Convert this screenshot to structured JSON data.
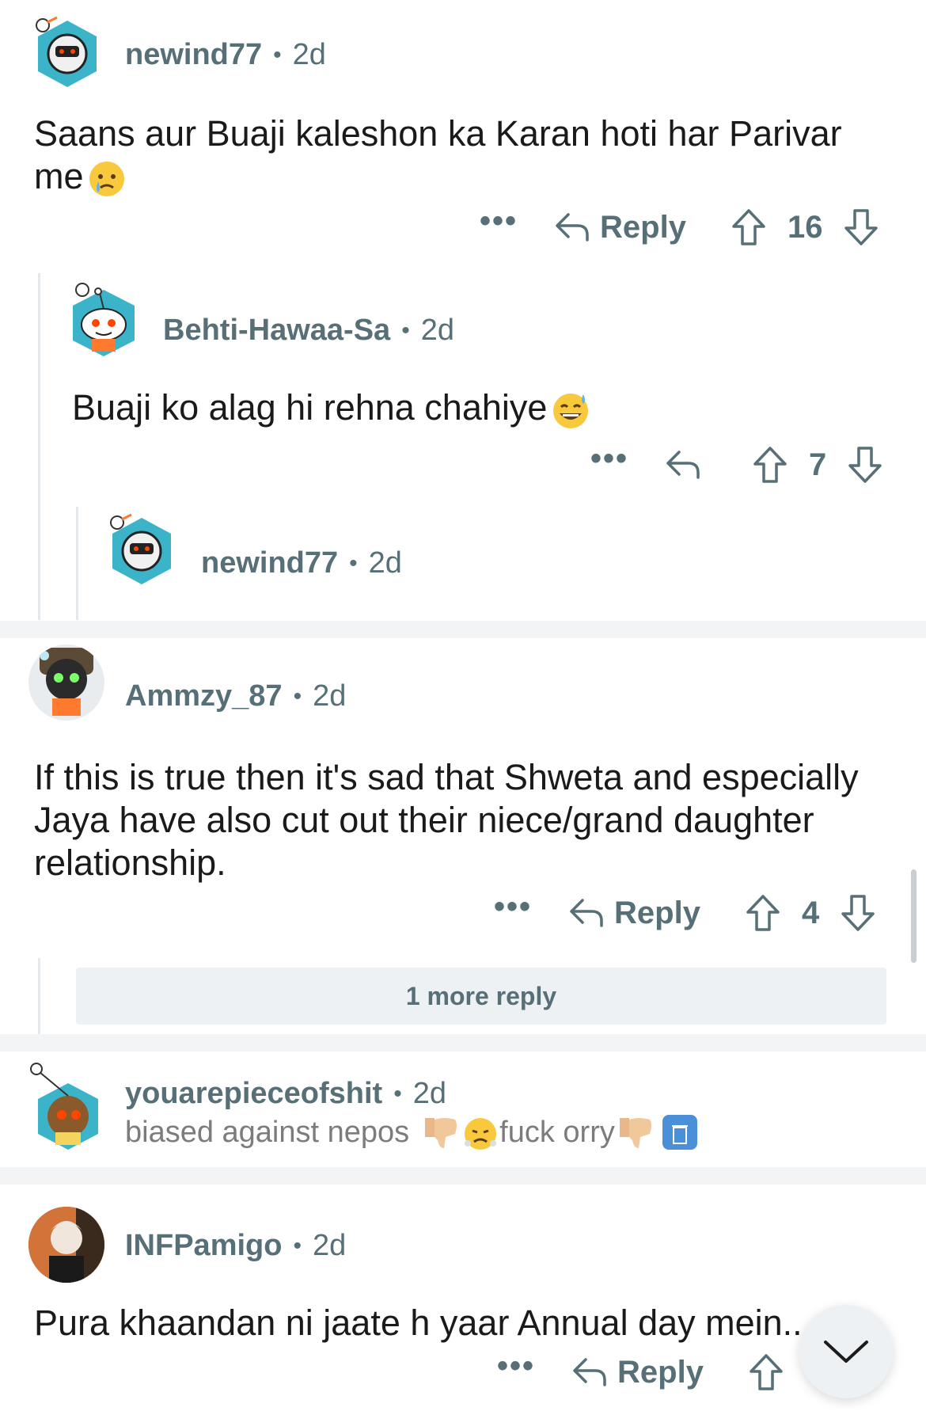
{
  "comments": [
    {
      "username": "newind77",
      "age": "2d",
      "body_line1": "Saans aur Buaji kaleshon ka Karan hoti har Parivar",
      "body_line2": "me",
      "reply_label": "Reply",
      "votes": "16",
      "more": "•••"
    },
    {
      "username": "Behti-Hawaa-Sa",
      "age": "2d",
      "body": "Buaji ko alag hi rehna chahiye",
      "votes": "7",
      "more": "•••"
    },
    {
      "username": "newind77",
      "age": "2d"
    },
    {
      "username": "Ammzy_87",
      "age": "2d",
      "body_line1": "If this is true then it's sad that Shweta and especially",
      "body_line2": "Jaya have also cut out their niece/grand daughter",
      "body_line3": "relationship.",
      "reply_label": "Reply",
      "votes": "4",
      "more": "•••",
      "more_replies": "1 more reply"
    },
    {
      "username": "youarepieceofshit",
      "age": "2d",
      "flair_text1": "biased against nepos",
      "flair_text2": "fuck orry"
    },
    {
      "username": "INFPamigo",
      "age": "2d",
      "body": "Pura khaandan ni jaate h yaar Annual day mein..",
      "reply_label": "Reply",
      "more": "•••"
    }
  ],
  "dot": "•",
  "icons": [
    "reply-arrow-icon",
    "upvote-arrow-icon",
    "downvote-arrow-icon",
    "more-options-icon",
    "chevron-down-icon"
  ],
  "colors": {
    "meta": "#576f76",
    "separator": "#f2f4f5",
    "thread_line": "#e6e9eb"
  }
}
